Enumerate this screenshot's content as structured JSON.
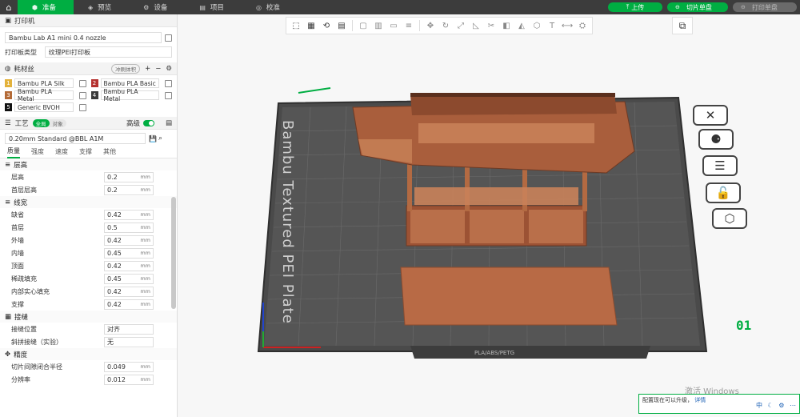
{
  "tabs": [
    {
      "label": "准备",
      "icon": "box-icon"
    },
    {
      "label": "预览",
      "icon": "layers-icon"
    },
    {
      "label": "设备",
      "icon": "gear-icon"
    },
    {
      "label": "项目",
      "icon": "document-icon"
    },
    {
      "label": "校准",
      "icon": "target-icon"
    }
  ],
  "topbar": {
    "upload": "上传",
    "slice": "切片单盘",
    "print": "打印单盘"
  },
  "printer": {
    "section": "打印机",
    "name": "Bambu Lab A1 mini 0.4 nozzle",
    "plate_type_label": "打印板类型",
    "plate_type": "纹理PEI打印板"
  },
  "filament": {
    "section": "耗材丝",
    "flush_label": "冲刷体积",
    "items": [
      {
        "num": "1",
        "name": "Bambu PLA Silk",
        "color": "#e3b23c"
      },
      {
        "num": "2",
        "name": "Bambu PLA Basic",
        "color": "#b5312f"
      },
      {
        "num": "3",
        "name": "Bambu PLA Metal",
        "color": "#b36a36"
      },
      {
        "num": "4",
        "name": "Bambu PLA Metal",
        "color": "#3a3a3a"
      },
      {
        "num": "5",
        "name": "Generic BVOH",
        "color": "#111111"
      }
    ]
  },
  "process": {
    "section": "工艺",
    "global": "全局",
    "object": "对象",
    "advanced": "高级",
    "preset": "0.20mm Standard @BBL A1M",
    "subtabs": [
      "质量",
      "强度",
      "速度",
      "支撑",
      "其他"
    ]
  },
  "params": {
    "layer_group": "层高",
    "layer_height": {
      "label": "层高",
      "value": "0.2",
      "unit": "mm"
    },
    "first_layer": {
      "label": "首层层高",
      "value": "0.2",
      "unit": "mm"
    },
    "width_group": "线宽",
    "default": {
      "label": "缺省",
      "value": "0.42",
      "unit": "mm"
    },
    "first": {
      "label": "首层",
      "value": "0.5",
      "unit": "mm"
    },
    "outer": {
      "label": "外墙",
      "value": "0.42",
      "unit": "mm"
    },
    "inner": {
      "label": "内墙",
      "value": "0.45",
      "unit": "mm"
    },
    "top": {
      "label": "顶面",
      "value": "0.42",
      "unit": "mm"
    },
    "sparse": {
      "label": "稀疏填充",
      "value": "0.45",
      "unit": "mm"
    },
    "solid": {
      "label": "内部实心填充",
      "value": "0.42",
      "unit": "mm"
    },
    "support": {
      "label": "支撑",
      "value": "0.42",
      "unit": "mm"
    },
    "seam_group": "接缝",
    "seam_pos": {
      "label": "接缝位置",
      "value": "对齐"
    },
    "scarf": {
      "label": "斜拼接缝（实验）",
      "value": "无"
    },
    "precision_group": "精度",
    "slice_gap": {
      "label": "切片间隙闭合半径",
      "value": "0.049",
      "unit": "mm"
    },
    "resolution": {
      "label": "分辨率",
      "value": "0.012",
      "unit": "mm"
    }
  },
  "viewport": {
    "plate_label": "Bambu Textured PEI Plate",
    "plate_number": "01",
    "plate_bottom_text": "PLA/ABS/PETG",
    "watermark": "激活 Windows",
    "toast_text": "配置现在可以升级，",
    "toast_link": "详情"
  }
}
